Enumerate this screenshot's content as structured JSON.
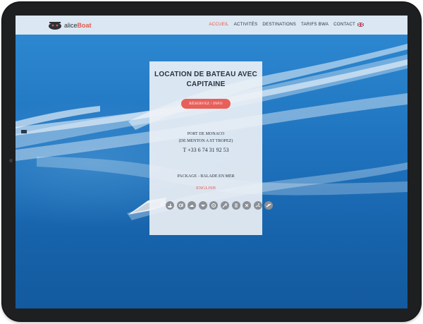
{
  "brand": {
    "logo_part1": "alice",
    "logo_part2": "Boat"
  },
  "nav": {
    "items": [
      {
        "label": "ACCUEIL",
        "active": true
      },
      {
        "label": "ACTIVITÉS",
        "active": false
      },
      {
        "label": "DESTINATIONS",
        "active": false
      },
      {
        "label": "TARIFS BWA",
        "active": false
      },
      {
        "label": "CONTACT",
        "active": false
      }
    ],
    "language_flag": "uk-flag-icon"
  },
  "hero": {
    "title_line1": "LOCATION DE BATEAU AVEC",
    "title_line2": "CAPITAINE",
    "cta_label": "RÉSERVEZ / INFO",
    "location_line1": "PORT DE MONACO",
    "location_line2": "(DE MENTON A ST TROPEZ)",
    "phone": "T +33 6 74 31 92 53",
    "package_label": "PACKAGE - BALADE EN MER",
    "language_link": "ENGLISH"
  },
  "activity_icons": [
    "boat-ride-icon",
    "snorkel-icon",
    "jetski-icon",
    "seaplane-icon",
    "diving-icon",
    "fishing-icon",
    "whale-watching-icon",
    "tubing-icon",
    "swimmer-icon",
    "wakeboard-icon"
  ],
  "colors": {
    "accent": "#e4574a",
    "button": "#e8605a",
    "sea": "#1f73be",
    "text": "#2a3340"
  }
}
